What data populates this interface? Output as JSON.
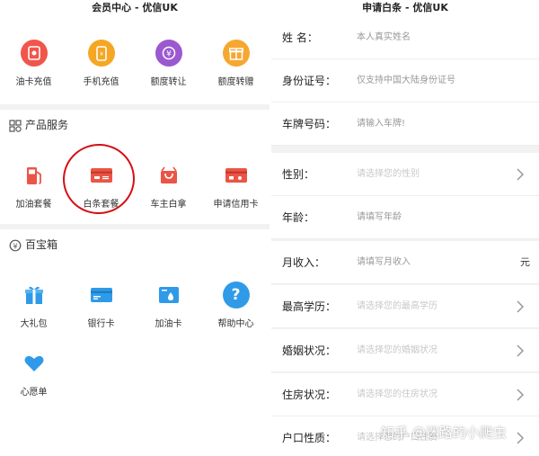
{
  "left": {
    "title": "会员中心 - 优信UK",
    "top_items": [
      {
        "label": "油卡充值",
        "icon": "fuel-card-icon",
        "color": "#f0564b"
      },
      {
        "label": "手机充值",
        "icon": "phone-recharge-icon",
        "color": "#f5a623"
      },
      {
        "label": "额度转让",
        "icon": "credit-transfer-icon",
        "color": "#9b59d0"
      },
      {
        "label": "额度转赠",
        "icon": "gift-box-icon",
        "color": "#f6a730"
      }
    ],
    "products": {
      "title": "产品服务",
      "items": [
        {
          "label": "加油套餐",
          "icon": "fuel-pump-icon"
        },
        {
          "label": "白条套餐",
          "icon": "credit-card-icon"
        },
        {
          "label": "车主白拿",
          "icon": "shopping-bag-icon"
        },
        {
          "label": "申请信用卡",
          "icon": "bank-card-icon"
        }
      ]
    },
    "treasure": {
      "title": "百宝箱",
      "items": [
        {
          "label": "大礼包",
          "icon": "gift-icon"
        },
        {
          "label": "银行卡",
          "icon": "bank-card-icon"
        },
        {
          "label": "加油卡",
          "icon": "fuel-drop-card-icon"
        },
        {
          "label": "帮助中心",
          "icon": "help-icon"
        },
        {
          "label": "心愿单",
          "icon": "heart-icon"
        }
      ]
    },
    "accent": "#e84c3d"
  },
  "right": {
    "title": "申请白条 - 优信UK",
    "fields": [
      {
        "label": "姓 名：",
        "placeholder": "本人真实姓名"
      },
      {
        "label": "身份证号：",
        "placeholder": "仅支持中国大陆身份证号"
      },
      {
        "label": "车牌号码：",
        "placeholder": "请输入车牌!"
      },
      {
        "label": "性别：",
        "placeholder": "请选择您的性别"
      },
      {
        "label": "年龄：",
        "placeholder": "请填写年龄"
      },
      {
        "label": "月收入：",
        "placeholder": "请填写月收入",
        "unit": "元"
      },
      {
        "label": "最高学历：",
        "placeholder": "请选择您的最高学历"
      },
      {
        "label": "婚姻状况：",
        "placeholder": "请选择您的婚姻状况"
      },
      {
        "label": "住房状况：",
        "placeholder": "请选择您的住房状况"
      },
      {
        "label": "户口性质：",
        "placeholder": "请选择您的户口性质"
      }
    ]
  },
  "watermark": "知乎 @迷路的小爬虫"
}
